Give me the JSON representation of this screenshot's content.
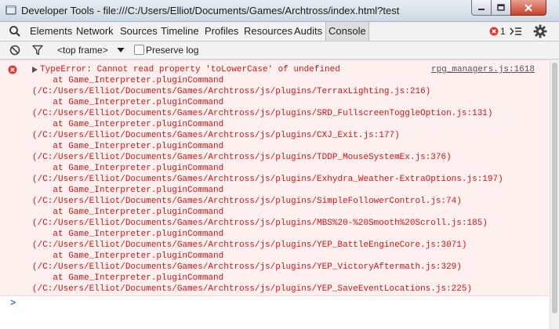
{
  "window": {
    "title": "Developer Tools - file:///C:/Users/Elliot/Documents/Games/Archtross/index.html?test"
  },
  "tabs": [
    "Elements",
    "Network",
    "Sources",
    "Timeline",
    "Profiles",
    "Resources",
    "Audits",
    "Console"
  ],
  "active_tab": "Console",
  "error_count": "1",
  "toolbar": {
    "frame_label": "<top frame>",
    "preserve_log_label": "Preserve log"
  },
  "error": {
    "source": "rpg_managers.js:1618",
    "lines": [
      "TypeError: Cannot read property 'toLowerCase' of undefined",
      "    at Game_Interpreter.pluginCommand",
      "(/C:/Users/Elliot/Documents/Games/Archtross/js/plugins/TerraxLighting.js:216)",
      "    at Game_Interpreter.pluginCommand",
      "(/C:/Users/Elliot/Documents/Games/Archtross/js/plugins/SRD_FullscreenToggleOption.js:131)",
      "    at Game_Interpreter.pluginCommand",
      "(/C:/Users/Elliot/Documents/Games/Archtross/js/plugins/CXJ_Exit.js:177)",
      "    at Game_Interpreter.pluginCommand",
      "(/C:/Users/Elliot/Documents/Games/Archtross/js/plugins/TDDP_MouseSystemEx.js:376)",
      "    at Game_Interpreter.pluginCommand",
      "(/C:/Users/Elliot/Documents/Games/Archtross/js/plugins/Exhydra_Weather-ExtraOptions.js:197)",
      "    at Game_Interpreter.pluginCommand",
      "(/C:/Users/Elliot/Documents/Games/Archtross/js/plugins/SimpleFollowerControl.js:74)",
      "    at Game_Interpreter.pluginCommand",
      "(/C:/Users/Elliot/Documents/Games/Archtross/js/plugins/MBS%20-%20Smooth%20Scroll.js:185)",
      "    at Game_Interpreter.pluginCommand",
      "(/C:/Users/Elliot/Documents/Games/Archtross/js/plugins/YEP_BattleEngineCore.js:3071)",
      "    at Game_Interpreter.pluginCommand",
      "(/C:/Users/Elliot/Documents/Games/Archtross/js/plugins/YEP_VictoryAftermath.js:329)",
      "    at Game_Interpreter.pluginCommand",
      "(/C:/Users/Elliot/Documents/Games/Archtross/js/plugins/YEP_SaveEventLocations.js:225)"
    ]
  },
  "prompt_symbol": ">",
  "colors": {
    "error": "#dd1111",
    "prompt": "#2b7bd6",
    "close": "#c5412a"
  }
}
